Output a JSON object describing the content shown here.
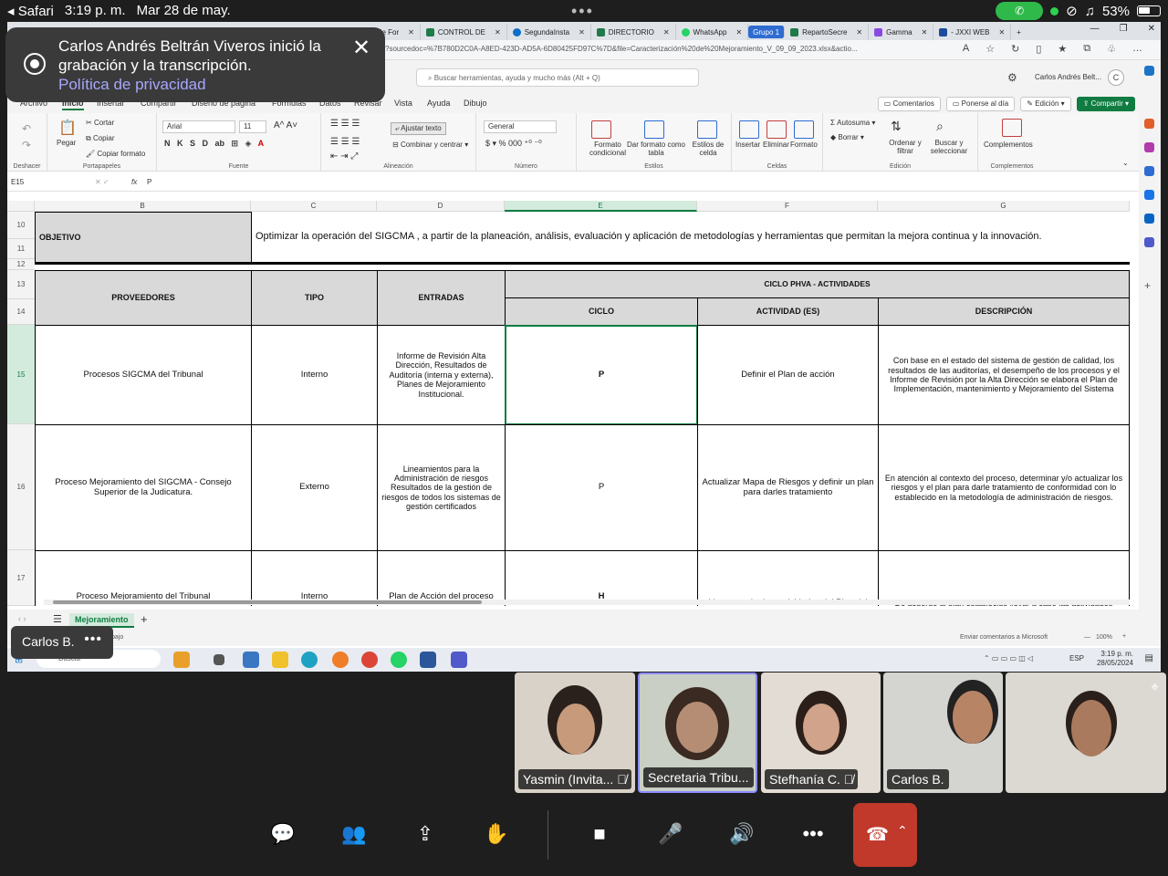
{
  "ios": {
    "app": "◂ Safari",
    "time": "3:19 p. m.",
    "date": "Mar 28 de may.",
    "battery": "53%"
  },
  "toast": {
    "message": "Carlos Andrés Beltrán Viveros inició la grabación y la transcripción.",
    "link": "Política de privacidad"
  },
  "browser": {
    "tabs": [
      {
        "label": "de For"
      },
      {
        "label": "CONTROL DE"
      },
      {
        "label": "SegundaInsta"
      },
      {
        "label": "DIRECTORIO"
      },
      {
        "label": "WhatsApp"
      },
      {
        "label": "Grupo 1"
      },
      {
        "label": "RepartoSecre"
      },
      {
        "label": "Gamma"
      },
      {
        "label": "- JXXI WEB"
      }
    ],
    "address": "x?sourcedoc=%7B780D2C0A-A8ED-423D-AD5A-6D80425FD97C%7D&file=Caracterización%20de%20Mejoramiento_V_09_09_2023.xlsx&actio..."
  },
  "excel": {
    "search_placeholder": "Buscar herramientas, ayuda y mucho más (Alt + Q)",
    "user": "Carlos Andrés Belt...",
    "avatar": "C",
    "menu": [
      "Archivo",
      "Inicio",
      "Insertar",
      "Compartir",
      "Diseño de página",
      "Fórmulas",
      "Datos",
      "Revisar",
      "Vista",
      "Ayuda",
      "Dibujo"
    ],
    "menu_right": {
      "comments": "Comentarios",
      "catchup": "Ponerse al día",
      "edit": "Edición",
      "share": "Compartir"
    },
    "ribbon": {
      "undo_group": "Deshacer",
      "paste": "Pegar",
      "cut": "Cortar",
      "copy": "Copiar",
      "format_painter": "Copiar formato",
      "clipboard": "Portapapeles",
      "font_name": "Arial",
      "font_size": "11",
      "font_group": "Fuente",
      "wrap": "Ajustar texto",
      "merge": "Combinar y centrar",
      "align_group": "Alineación",
      "number_format": "General",
      "number_group": "Número",
      "cond_format": "Formato condicional",
      "table_format": "Dar formato como tabla",
      "cell_styles": "Estilos de celda",
      "styles_group": "Estilos",
      "insert": "Insertar",
      "delete": "Eliminar",
      "format": "Formato",
      "cells_group": "Celdas",
      "autosum": "Autosuma",
      "clear": "Borrar",
      "sort": "Ordenar y filtrar",
      "find": "Buscar y seleccionar",
      "edit_group": "Edición",
      "addins": "Complementos",
      "addins_group": "Complementos"
    },
    "name_box": "E15",
    "formula": "P",
    "columns": [
      "B",
      "C",
      "D",
      "E",
      "F",
      "G"
    ],
    "rows": [
      "10",
      "11",
      "12",
      "13",
      "14",
      "15",
      "16",
      "17"
    ],
    "objetivo_label": "OBJETIVO",
    "objetivo_text": "Optimizar la operación del SIGCMA , a partir de la planeación, análisis, evaluación y aplicación de metodologías y herramientas que permitan la mejora continua y la innovación.",
    "headers": {
      "proveedores": "PROVEEDORES",
      "tipo": "TIPO",
      "entradas": "ENTRADAS",
      "ciclo_phva": "CICLO PHVA - ACTIVIDADES",
      "ciclo": "CICLO",
      "actividad": "ACTIVIDAD (ES)",
      "descripcion": "DESCRIPCIÓN"
    },
    "data_rows": [
      {
        "proveedor": "Procesos SIGCMA del Tribunal",
        "tipo": "Interno",
        "entradas": "Informe de Revisión Alta Dirección, Resultados de Auditoría (interna y externa), Planes de Mejoramiento Institucional.",
        "ciclo": "P",
        "actividad": "Definir el Plan de acción",
        "descripcion": "Con base en el estado del sistema de gestión de calidad, los resultados de las auditorías, el desempeño de los procesos y el Informe de Revisión por la Alta Dirección se elabora el Plan de Implementación, mantenimiento y Mejoramiento del Sistema"
      },
      {
        "proveedor": "Proceso Mejoramiento del SIGCMA - Consejo Superior de la Judicatura.",
        "tipo": "Externo",
        "entradas": "Lineamientos para la Administración de riesgos Resultados de la gestión de riesgos de todos los sistemas de gestión certificados",
        "ciclo": "P",
        "actividad": "Actualizar Mapa de Riesgos y definir un plan para darles tratamiento",
        "descripcion": "En atención al contexto del proceso, determinar y/o actualizar los riesgos y el plan para darle tratamiento de conformidad con lo establecido en la metodología de administración de riesgos."
      },
      {
        "proveedor": "Proceso Mejoramiento del Tribunal",
        "tipo": "Interno",
        "entradas": "Plan de Acción del proceso",
        "ciclo": "H",
        "actividad": "Llevar a cabo las actividades del Plan del",
        "descripcion": "De acuerdo al plan establecido llevar a cabo las actividades"
      }
    ],
    "sheet_tab": "Mejoramiento",
    "status_left": "bajo",
    "feedback": "Enviar comentarios a Microsoft",
    "zoom": "100%"
  },
  "taskbar": {
    "search": "Buscar",
    "lang": "ESP",
    "clock_time": "3:19 p. m.",
    "clock_date": "28/05/2024"
  },
  "meeting": {
    "presenter_pill": "Carlos B.",
    "participants": [
      {
        "name": "Yasmin (Invita..."
      },
      {
        "name": "Secretaria Tribu..."
      },
      {
        "name": "Stefhanía C."
      },
      {
        "name": "Carlos B."
      }
    ]
  }
}
